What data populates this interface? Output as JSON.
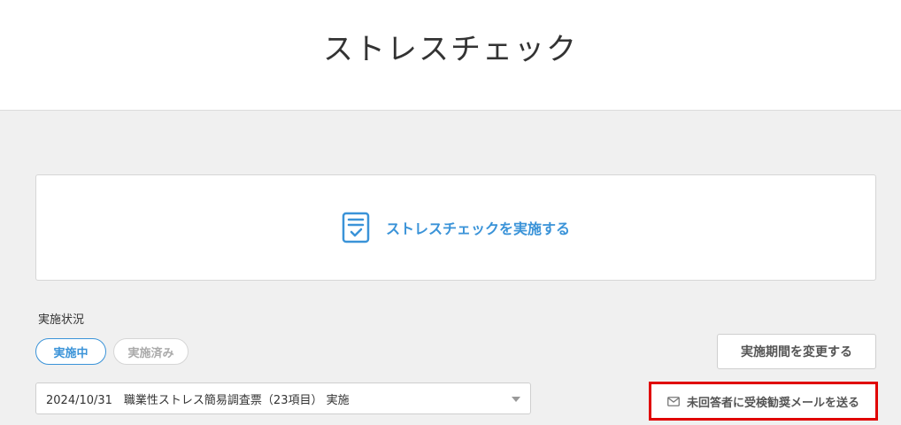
{
  "header": {
    "title": "ストレスチェック"
  },
  "start_card": {
    "label": "ストレスチェックを実施する",
    "icon": "clipboard-check-icon"
  },
  "status": {
    "label": "実施状況",
    "tabs": [
      {
        "label": "実施中",
        "active": true
      },
      {
        "label": "実施済み",
        "active": false
      }
    ]
  },
  "actions": {
    "change_period_label": "実施期間を変更する",
    "reminder_label": "未回答者に受検勧奨メールを送る",
    "reminder_icon": "mail-icon"
  },
  "survey_select": {
    "value": "2024/10/31　職業性ストレス簡易調査票（23項目） 実施"
  },
  "colors": {
    "accent": "#3a93d8",
    "highlight": "#e00000",
    "background": "#f0f0f0"
  }
}
